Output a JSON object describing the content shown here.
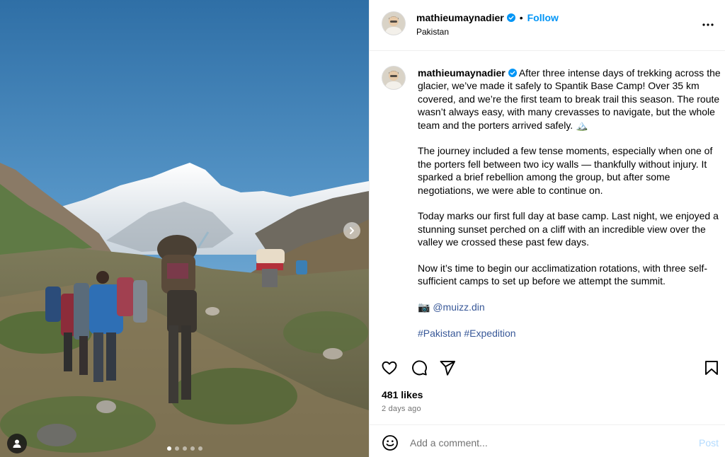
{
  "post": {
    "username": "mathieumaynadier",
    "location": "Pakistan",
    "follow_label": "Follow",
    "bullet": "•",
    "caption": {
      "p1": "After three intense days of trekking across the glacier, we’ve made it safely to Spantik Base Camp! Over 35 km covered, and we’re the first team to break trail this season. The route wasn’t always easy, with many crevasses to navigate, but the whole team and the porters arrived safely. 🏔️",
      "p2": "The journey included a few tense moments, especially when one of the porters fell between two icy walls — thankfully without injury. It sparked a brief rebellion among the group, but after some negotiations, we were able to continue on.",
      "p3": "Today marks our first full day at base camp. Last night, we enjoyed a stunning sunset perched on a cliff with an incredible view over the valley we crossed these past few days.",
      "p4": "Now it’s time to begin our acclimatization rotations, with three self-sufficient camps to set up before we attempt the summit.",
      "credit_emoji": "📷",
      "credit_handle": "@muizz.din",
      "hashtags": [
        "#Pakistan",
        "#Expedition"
      ]
    },
    "likes_text": "481 likes",
    "time_text": "2 days ago",
    "comment_placeholder": "Add a comment...",
    "post_label": "Post",
    "carousel": {
      "count": 5,
      "active": 0
    }
  },
  "colors": {
    "follow": "#0095f6",
    "hashtag": "#385898",
    "post_disabled": "#b3dbff",
    "verified": "#0095f6"
  },
  "icons": {
    "more": "more-horizontal-icon",
    "like": "heart-icon",
    "comment": "comment-bubble-icon",
    "share": "paper-plane-icon",
    "save": "bookmark-icon",
    "emoji": "smiley-icon",
    "next": "chevron-right-icon",
    "tags": "user-tag-icon",
    "verified": "verified-badge-icon"
  }
}
